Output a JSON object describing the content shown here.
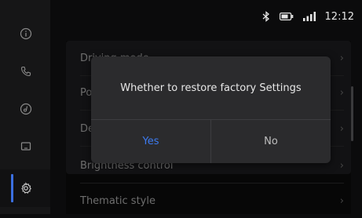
{
  "status_bar": {
    "time": "12:12",
    "icons": [
      "bluetooth-icon",
      "battery-icon",
      "signal-icon"
    ]
  },
  "sidebar": {
    "items": [
      {
        "name": "info",
        "icon": "info-icon"
      },
      {
        "name": "phone",
        "icon": "phone-icon"
      },
      {
        "name": "music",
        "icon": "music-icon"
      },
      {
        "name": "display",
        "icon": "screen-icon"
      },
      {
        "name": "settings",
        "icon": "gear-icon",
        "active": true
      }
    ],
    "accent": "#3b6fe0"
  },
  "settings_list": {
    "items": [
      {
        "label": "Driving mode"
      },
      {
        "label": "Po"
      },
      {
        "label": "De"
      },
      {
        "label": "Brightness control"
      },
      {
        "label": "Thematic style"
      }
    ]
  },
  "dialog": {
    "message": "Whether to restore factory Settings",
    "yes_label": "Yes",
    "no_label": "No",
    "yes_color": "#3d7bf0"
  }
}
